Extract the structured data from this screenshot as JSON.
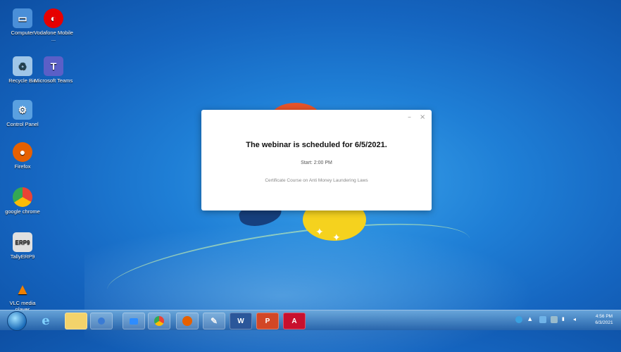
{
  "desktop_icons": [
    {
      "label": "Computer",
      "icon": "computer-icon",
      "color": "#4a8fd8"
    },
    {
      "label": "Vodafone Mobile ...",
      "icon": "vodafone-icon",
      "color": "#e60000"
    },
    {
      "label": "Recycle Bin",
      "icon": "recycle-bin-icon",
      "color": "#9fc6e8"
    },
    {
      "label": "Microsoft Teams",
      "icon": "teams-icon",
      "color": "#5b5fc7"
    },
    {
      "label": "Control Panel",
      "icon": "control-panel-icon",
      "color": "#5aa0e0"
    },
    {
      "label": "Firefox",
      "icon": "firefox-icon",
      "color": "#e66000"
    },
    {
      "label": "google chrome",
      "icon": "chrome-icon",
      "color": "#34a853"
    },
    {
      "label": "TallyERP9",
      "icon": "tally-icon",
      "color": "#e0e0e0"
    },
    {
      "label": "VLC media player",
      "icon": "vlc-icon",
      "color": "#f08000"
    }
  ],
  "dialog": {
    "minimize": "–",
    "close": "×",
    "title": "The webinar is scheduled for 6/5/2021.",
    "start": "Start: 2:00 PM",
    "course": "Certificate Course on Anti Money Laundering Laws"
  },
  "taskbar": {
    "apps": [
      {
        "name": "internet-explorer",
        "glyph": "e"
      },
      {
        "name": "file-explorer",
        "glyph": ""
      },
      {
        "name": "media-player",
        "glyph": ""
      },
      {
        "name": "zoom",
        "glyph": ""
      },
      {
        "name": "chrome",
        "glyph": ""
      },
      {
        "name": "firefox",
        "glyph": ""
      },
      {
        "name": "paint",
        "glyph": ""
      },
      {
        "name": "word",
        "glyph": "W"
      },
      {
        "name": "powerpoint",
        "glyph": "P"
      },
      {
        "name": "acrobat",
        "glyph": "A"
      }
    ],
    "time": "4:56 PM",
    "date": "6/3/2021"
  }
}
